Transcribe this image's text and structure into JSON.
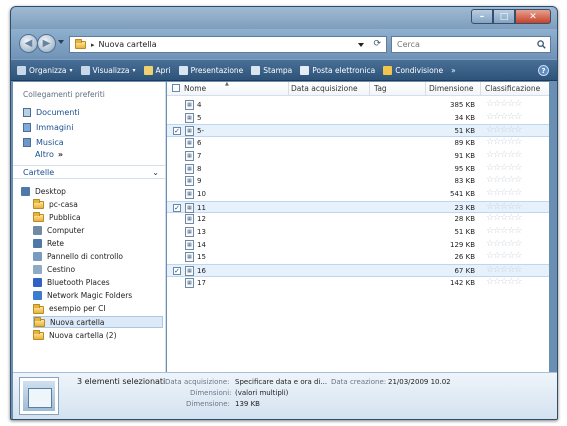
{
  "window": {
    "controls": {
      "minimize": "–",
      "maximize": "□",
      "close": "✕"
    }
  },
  "address": {
    "crumb_separator": "▸",
    "current_folder": "Nuova cartella",
    "refresh_icon": "refresh-icon"
  },
  "search": {
    "placeholder": "Cerca"
  },
  "toolbar": {
    "items": [
      {
        "label": "Organizza",
        "caret": "▾",
        "icon": "organize-icon",
        "color": "#c9d8e8"
      },
      {
        "label": "Visualizza",
        "caret": "▾",
        "icon": "views-icon",
        "color": "#c9d8e8"
      },
      {
        "label": "Apri",
        "caret": "",
        "icon": "open-icon",
        "color": "#f0d070"
      },
      {
        "label": "Presentazione",
        "caret": "",
        "icon": "slideshow-icon",
        "color": "#d9e6f2"
      },
      {
        "label": "Stampa",
        "caret": "",
        "icon": "print-icon",
        "color": "#d9e6f2"
      },
      {
        "label": "Posta elettronica",
        "caret": "",
        "icon": "mail-icon",
        "color": "#e5eef7"
      },
      {
        "label": "Condivisione",
        "caret": "",
        "icon": "share-icon",
        "color": "#f2c44a"
      }
    ],
    "overflow": "»",
    "help": "?"
  },
  "nav": {
    "favorites_header": "Collegamenti preferiti",
    "favorites": [
      {
        "label": "Documenti",
        "color": "#b8cfe6"
      },
      {
        "label": "Immagini",
        "color": "#7fa9d8"
      },
      {
        "label": "Musica",
        "color": "#6d97c9"
      }
    ],
    "more_label": "Altro",
    "more_chevron": "»",
    "folders_label": "Cartelle",
    "folders_chevron": "⌄",
    "tree": [
      {
        "label": "Desktop",
        "type": "desktop",
        "color": "#4f79a8",
        "bold": false
      },
      {
        "label": "pc-casa",
        "type": "folder",
        "color": "",
        "bold": false
      },
      {
        "label": "Pubblica",
        "type": "folder",
        "color": "",
        "bold": false
      },
      {
        "label": "Computer",
        "type": "icon",
        "color": "#6f8aa6",
        "bold": false
      },
      {
        "label": "Rete",
        "type": "icon",
        "color": "#4d78a8",
        "bold": false
      },
      {
        "label": "Pannello di controllo",
        "type": "icon",
        "color": "#7a9bbf",
        "bold": false
      },
      {
        "label": "Cestino",
        "type": "icon",
        "color": "#8faac3",
        "bold": false
      },
      {
        "label": "Bluetooth Places",
        "type": "icon",
        "color": "#2f62c4",
        "bold": false
      },
      {
        "label": "Network Magic Folders",
        "type": "icon",
        "color": "#3b7bd0",
        "bold": false
      },
      {
        "label": "esempio per CI",
        "type": "folder",
        "color": "",
        "bold": false
      },
      {
        "label": "Nuova cartella",
        "type": "folder",
        "color": "",
        "bold": false,
        "selected": true
      },
      {
        "label": "Nuova cartella (2)",
        "type": "folder",
        "color": "",
        "bold": false
      }
    ]
  },
  "columns": {
    "name": "Nome",
    "date": "Data acquisizione",
    "tag": "Tag",
    "size": "Dimensione",
    "rating": "Classificazione"
  },
  "files": [
    {
      "name": "4",
      "size": "385 KB",
      "selected": false
    },
    {
      "name": "5",
      "size": "34 KB",
      "selected": false
    },
    {
      "name": "5-",
      "size": "51 KB",
      "selected": true
    },
    {
      "name": "6",
      "size": "89 KB",
      "selected": false
    },
    {
      "name": "7",
      "size": "91 KB",
      "selected": false
    },
    {
      "name": "8",
      "size": "95 KB",
      "selected": false
    },
    {
      "name": "9",
      "size": "83 KB",
      "selected": false
    },
    {
      "name": "10",
      "size": "541 KB",
      "selected": false
    },
    {
      "name": "11",
      "size": "23 KB",
      "selected": true
    },
    {
      "name": "12",
      "size": "28 KB",
      "selected": false
    },
    {
      "name": "13",
      "size": "51 KB",
      "selected": false
    },
    {
      "name": "14",
      "size": "129 KB",
      "selected": false
    },
    {
      "name": "15",
      "size": "26 KB",
      "selected": false
    },
    {
      "name": "16",
      "size": "67 KB",
      "selected": true
    },
    {
      "name": "17",
      "size": "142 KB",
      "selected": false
    }
  ],
  "file_icon_glyph": "▦",
  "rating_glyph": "☆☆☆☆☆",
  "details": {
    "selection": "3 elementi selezionati",
    "date_label": "Data acquisizione:",
    "date_value": "Specificare data e ora di...",
    "created_label": "Data creazione:",
    "created_value": "21/03/2009 10.02",
    "dims_label": "Dimensioni:",
    "dims_value": "(valori multipli)",
    "size_label": "Dimensione:",
    "size_value": "139 KB"
  }
}
